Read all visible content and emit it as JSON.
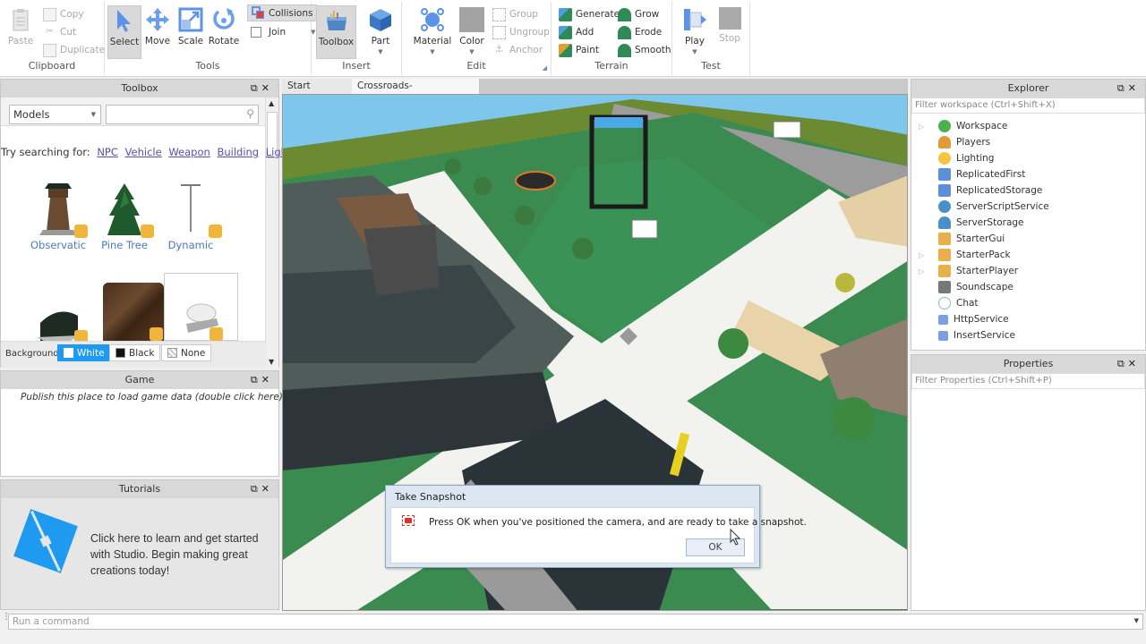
{
  "ribbon": {
    "clipboard": {
      "label": "Clipboard",
      "paste": "Paste",
      "copy": "Copy",
      "cut": "Cut",
      "duplicate": "Duplicate"
    },
    "tools": {
      "label": "Tools",
      "select": "Select",
      "move": "Move",
      "scale": "Scale",
      "rotate": "Rotate",
      "collisions": "Collisions",
      "join": "Join"
    },
    "insert": {
      "label": "Insert",
      "toolbox": "Toolbox",
      "part": "Part"
    },
    "edit": {
      "label": "Edit",
      "material": "Material",
      "color": "Color",
      "group": "Group",
      "ungroup": "Ungroup",
      "anchor": "Anchor"
    },
    "terrain": {
      "label": "Terrain",
      "generate": "Generate",
      "add": "Add",
      "paint": "Paint",
      "grow": "Grow",
      "erode": "Erode",
      "smooth": "Smooth"
    },
    "test": {
      "label": "Test",
      "play": "Play",
      "stop": "Stop"
    }
  },
  "toolbox": {
    "title": "Toolbox",
    "category": "Models",
    "search_value": "",
    "suggest_prefix": "Try searching for:",
    "suggestions": [
      "NPC",
      "Vehicle",
      "Weapon",
      "Building",
      "Light"
    ],
    "items": [
      {
        "label": "Observatic"
      },
      {
        "label": "Pine Tree"
      },
      {
        "label": "Dynamic"
      },
      {
        "label": ""
      },
      {
        "label": ""
      },
      {
        "label": ""
      }
    ],
    "background_label": "Background:",
    "bg_options": [
      "White",
      "Black",
      "None"
    ],
    "bg_selected": "White"
  },
  "game": {
    "title": "Game",
    "message": "Publish this place to load game data (double click here)"
  },
  "tutorials": {
    "title": "Tutorials",
    "message": "Click here to learn and get started with Studio. Begin making great creations today!"
  },
  "tabs": [
    {
      "label": "Start Page",
      "active": false
    },
    {
      "label": "Crossroads-RBLXDEV.rbxl",
      "active": true
    }
  ],
  "explorer": {
    "title": "Explorer",
    "filter_placeholder": "Filter workspace (Ctrl+Shift+X)",
    "items": [
      {
        "label": "Workspace",
        "expandable": true,
        "icon": "globe-icon",
        "color": "#4caf50"
      },
      {
        "label": "Players",
        "expandable": false,
        "icon": "players-icon",
        "color": "#e09a3c"
      },
      {
        "label": "Lighting",
        "expandable": false,
        "icon": "lightbulb-icon",
        "color": "#f5c542"
      },
      {
        "label": "ReplicatedFirst",
        "expandable": false,
        "icon": "replicated-icon",
        "color": "#5b8fd6"
      },
      {
        "label": "ReplicatedStorage",
        "expandable": false,
        "icon": "replicated-icon",
        "color": "#5b8fd6"
      },
      {
        "label": "ServerScriptService",
        "expandable": false,
        "icon": "server-script-icon",
        "color": "#4a90c8"
      },
      {
        "label": "ServerStorage",
        "expandable": false,
        "icon": "server-storage-icon",
        "color": "#4a90c8"
      },
      {
        "label": "StarterGui",
        "expandable": false,
        "icon": "folder-gui-icon",
        "color": "#e8b04a"
      },
      {
        "label": "StarterPack",
        "expandable": true,
        "icon": "folder-pack-icon",
        "color": "#e8b04a"
      },
      {
        "label": "StarterPlayer",
        "expandable": true,
        "icon": "folder-player-icon",
        "color": "#e8b04a"
      },
      {
        "label": "Soundscape",
        "expandable": false,
        "icon": "speaker-icon",
        "color": "#777777"
      },
      {
        "label": "Chat",
        "expandable": false,
        "icon": "chat-bubble-icon",
        "color": "#8ab4e0"
      },
      {
        "label": "HttpService",
        "expandable": false,
        "icon": "service-square-icon",
        "color": "#7b9fe0"
      },
      {
        "label": "InsertService",
        "expandable": false,
        "icon": "service-square-icon",
        "color": "#7b9fe0"
      }
    ]
  },
  "properties": {
    "title": "Properties",
    "filter_placeholder": "Filter Properties (Ctrl+Shift+P)"
  },
  "dialog": {
    "title": "Take Snapshot",
    "message": "Press OK when you've positioned the camera, and are ready to take a snapshot.",
    "ok": "OK"
  },
  "command": {
    "placeholder": "Run a command"
  },
  "colors": {
    "accent": "#1e9bf0",
    "link": "#5a4fa8",
    "roblox_blue": "#1e9bf0"
  }
}
